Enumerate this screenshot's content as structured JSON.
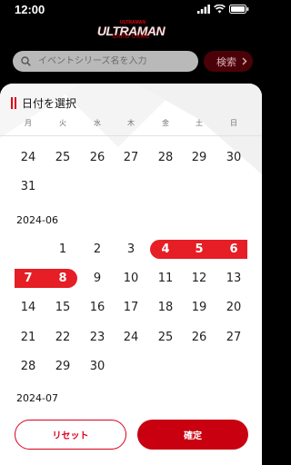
{
  "status": {
    "time": "12:00"
  },
  "logo": {
    "top": "ULTRAMAN",
    "main": "ULTRAMAN",
    "sub": "CARD GAME"
  },
  "search": {
    "placeholder": "イベントシリーズ名を入力",
    "button_label": "検索"
  },
  "sheet": {
    "title": "日付を選択",
    "weekdays": [
      "月",
      "火",
      "水",
      "木",
      "金",
      "土",
      "日"
    ]
  },
  "calendar": {
    "may_tail": {
      "row1": [
        "24",
        "25",
        "26",
        "27",
        "28",
        "29",
        "30"
      ],
      "row2": [
        "31"
      ]
    },
    "june": {
      "label": "2024-06",
      "row1": [
        "1",
        "2",
        "3",
        "4",
        "5",
        "6"
      ],
      "row2": [
        "7",
        "8",
        "9",
        "10",
        "11",
        "12",
        "13"
      ],
      "row3": [
        "14",
        "15",
        "16",
        "17",
        "18",
        "19",
        "20"
      ],
      "row4": [
        "21",
        "22",
        "23",
        "24",
        "25",
        "26",
        "27"
      ],
      "row5": [
        "28",
        "29",
        "30"
      ]
    },
    "july": {
      "label": "2024-07"
    }
  },
  "footer": {
    "reset_label": "リセット",
    "confirm_label": "確定"
  },
  "colors": {
    "accent": "#d9001b",
    "selection": "#e61e25",
    "confirm": "#c8000f"
  }
}
